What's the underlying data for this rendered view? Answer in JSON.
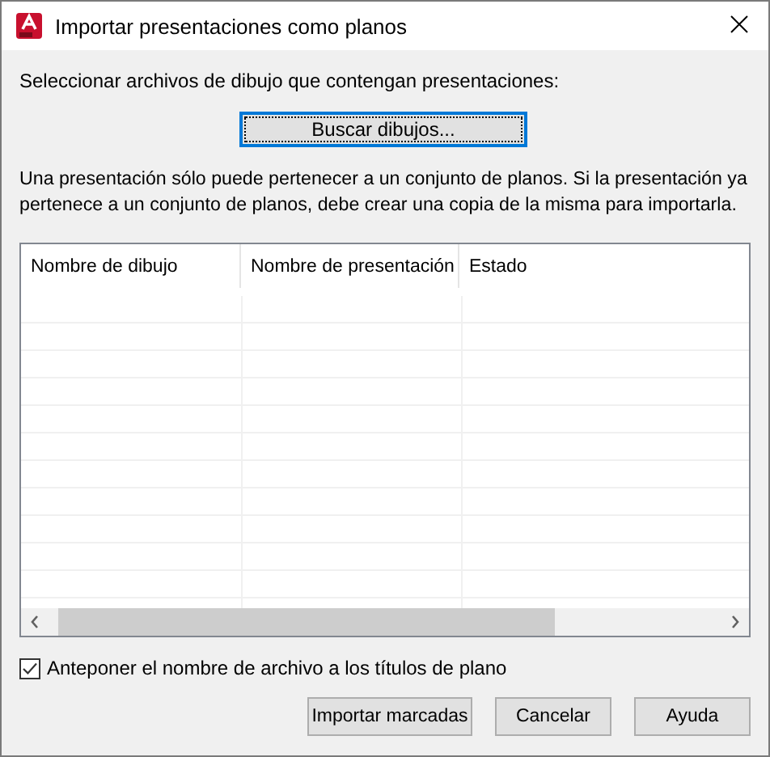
{
  "window": {
    "title": "Importar presentaciones como planos"
  },
  "select_label": "Seleccionar archivos de dibujo que contengan presentaciones:",
  "browse_button": "Buscar dibujos...",
  "note": "Una presentación sólo puede pertenecer a un conjunto de planos. Si la presentación ya pertenece a un conjunto de planos, debe crear una copia de la misma para importarla.",
  "table": {
    "columns": [
      "Nombre de dibujo",
      "Nombre de presentación",
      "Estado"
    ]
  },
  "prefix_option": {
    "label": "Anteponer el nombre de archivo a los títulos de plano",
    "checked": true
  },
  "buttons": [
    "Importar marcadas",
    "Cancelar",
    "Ayuda"
  ]
}
